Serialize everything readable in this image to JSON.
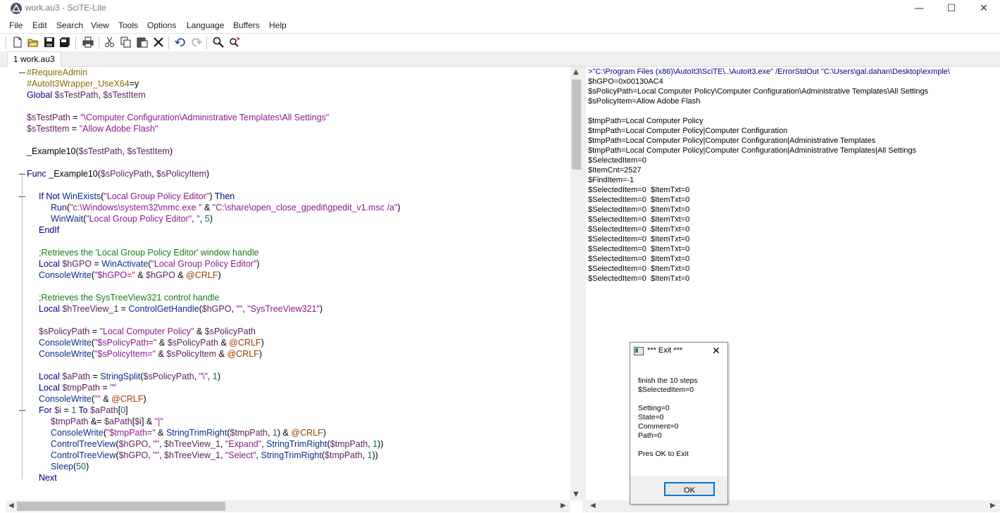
{
  "window": {
    "title": "work.au3 - SciTE-Lite",
    "minimize": "—",
    "maximize": "☐",
    "close": "✕"
  },
  "menu": [
    "File",
    "Edit",
    "Search",
    "View",
    "Tools",
    "Options",
    "Language",
    "Buffers",
    "Help"
  ],
  "toolbar": [
    "new-icon",
    "open-icon",
    "save-icon",
    "save-all-icon",
    "print-icon",
    "cut-icon",
    "copy-icon",
    "paste-icon",
    "delete-icon",
    "undo-icon",
    "redo-icon",
    "find-icon",
    "replace-icon"
  ],
  "tabs": [
    {
      "label": "1 work.au3"
    }
  ],
  "editor_lines": [
    {
      "indent": 0,
      "fold": "start",
      "tokens": [
        [
          "dir",
          "#RequireAdmin"
        ]
      ]
    },
    {
      "indent": 0,
      "tokens": [
        [
          "dir",
          "#AutoIt3Wrapper_UseX64"
        ],
        [
          "op",
          "=y"
        ]
      ]
    },
    {
      "indent": 0,
      "tokens": [
        [
          "kw",
          "Global "
        ],
        [
          "var",
          "$sTestPath"
        ],
        [
          "op",
          ", "
        ],
        [
          "var",
          "$sTestItem"
        ]
      ]
    },
    {
      "indent": 0,
      "tokens": []
    },
    {
      "indent": 0,
      "tokens": [
        [
          "var",
          "$sTestPath"
        ],
        [
          "op",
          " = "
        ],
        [
          "str",
          "\"\\Computer Configuration\\Administrative Templates\\All Settings\""
        ]
      ]
    },
    {
      "indent": 0,
      "tokens": [
        [
          "var",
          "$sTestItem"
        ],
        [
          "op",
          " = "
        ],
        [
          "str",
          "\"Allow Adobe Flash\""
        ]
      ]
    },
    {
      "indent": 0,
      "tokens": []
    },
    {
      "indent": 0,
      "tokens": [
        [
          "op",
          "_Example10("
        ],
        [
          "var",
          "$sTestPath"
        ],
        [
          "op",
          ", "
        ],
        [
          "var",
          "$sTestItem"
        ],
        [
          "op",
          ")"
        ]
      ]
    },
    {
      "indent": 0,
      "tokens": []
    },
    {
      "indent": 0,
      "fold": "start",
      "tokens": [
        [
          "kw",
          "Func "
        ],
        [
          "op",
          "_Example10("
        ],
        [
          "var",
          "$sPolicyPath"
        ],
        [
          "op",
          ", "
        ],
        [
          "var",
          "$sPolicyItem"
        ],
        [
          "op",
          ")"
        ]
      ]
    },
    {
      "indent": 0,
      "tokens": []
    },
    {
      "indent": 1,
      "fold": "start",
      "tokens": [
        [
          "kw",
          "If Not "
        ],
        [
          "func",
          "WinExists"
        ],
        [
          "op",
          "("
        ],
        [
          "str",
          "\"Local Group Policy Editor\""
        ],
        [
          "op",
          ") "
        ],
        [
          "kw",
          "Then"
        ]
      ]
    },
    {
      "indent": 2,
      "tokens": [
        [
          "func",
          "Run"
        ],
        [
          "op",
          "("
        ],
        [
          "str",
          "\"c:\\Windows\\system32\\mmc.exe \""
        ],
        [
          "op",
          " & "
        ],
        [
          "str",
          "\"C:\\share\\open_close_gpedit\\gpedit_v1.msc /a\""
        ],
        [
          "op",
          ")"
        ]
      ]
    },
    {
      "indent": 2,
      "tokens": [
        [
          "func",
          "WinWait"
        ],
        [
          "op",
          "("
        ],
        [
          "str",
          "\"Local Group Policy Editor\""
        ],
        [
          "op",
          ", "
        ],
        [
          "str",
          "''"
        ],
        [
          "op",
          ", "
        ],
        [
          "num",
          "5"
        ],
        [
          "op",
          ")"
        ]
      ]
    },
    {
      "indent": 1,
      "tokens": [
        [
          "kw",
          "EndIf"
        ]
      ]
    },
    {
      "indent": 0,
      "tokens": []
    },
    {
      "indent": 1,
      "tokens": [
        [
          "cmt",
          ";Retrieves the 'Local Group Policy Editor' window handle"
        ]
      ]
    },
    {
      "indent": 1,
      "tokens": [
        [
          "kw",
          "Local "
        ],
        [
          "var",
          "$hGPO"
        ],
        [
          "op",
          " = "
        ],
        [
          "func",
          "WinActivate"
        ],
        [
          "op",
          "("
        ],
        [
          "str",
          "\"Local Group Policy Editor\""
        ],
        [
          "op",
          ")"
        ]
      ]
    },
    {
      "indent": 1,
      "tokens": [
        [
          "func",
          "ConsoleWrite"
        ],
        [
          "op",
          "("
        ],
        [
          "str",
          "\"$hGPO=\""
        ],
        [
          "op",
          " & "
        ],
        [
          "var",
          "$hGPO"
        ],
        [
          "op",
          " & "
        ],
        [
          "mac",
          "@CRLF"
        ],
        [
          "op",
          ")"
        ]
      ]
    },
    {
      "indent": 0,
      "tokens": []
    },
    {
      "indent": 1,
      "tokens": [
        [
          "cmt",
          ";Retrieves the SysTreeView321 control handle"
        ]
      ]
    },
    {
      "indent": 1,
      "tokens": [
        [
          "kw",
          "Local "
        ],
        [
          "var",
          "$hTreeView_1"
        ],
        [
          "op",
          " = "
        ],
        [
          "func",
          "ControlGetHandle"
        ],
        [
          "op",
          "("
        ],
        [
          "var",
          "$hGPO"
        ],
        [
          "op",
          ", "
        ],
        [
          "str",
          "\"\""
        ],
        [
          "op",
          ", "
        ],
        [
          "str",
          "\"SysTreeView321\""
        ],
        [
          "op",
          ")"
        ]
      ]
    },
    {
      "indent": 0,
      "tokens": []
    },
    {
      "indent": 1,
      "tokens": [
        [
          "var",
          "$sPolicyPath"
        ],
        [
          "op",
          " = "
        ],
        [
          "str",
          "\"Local Computer Policy\""
        ],
        [
          "op",
          " & "
        ],
        [
          "var",
          "$sPolicyPath"
        ]
      ]
    },
    {
      "indent": 1,
      "tokens": [
        [
          "func",
          "ConsoleWrite"
        ],
        [
          "op",
          "("
        ],
        [
          "str",
          "\"$sPolicyPath=\""
        ],
        [
          "op",
          " & "
        ],
        [
          "var",
          "$sPolicyPath"
        ],
        [
          "op",
          " & "
        ],
        [
          "mac",
          "@CRLF"
        ],
        [
          "op",
          ")"
        ]
      ]
    },
    {
      "indent": 1,
      "tokens": [
        [
          "func",
          "ConsoleWrite"
        ],
        [
          "op",
          "("
        ],
        [
          "str",
          "\"$sPolicyItem=\""
        ],
        [
          "op",
          " & "
        ],
        [
          "var",
          "$sPolicyItem"
        ],
        [
          "op",
          " & "
        ],
        [
          "mac",
          "@CRLF"
        ],
        [
          "op",
          ")"
        ]
      ]
    },
    {
      "indent": 0,
      "tokens": []
    },
    {
      "indent": 1,
      "tokens": [
        [
          "kw",
          "Local "
        ],
        [
          "var",
          "$aPath"
        ],
        [
          "op",
          " = "
        ],
        [
          "func",
          "StringSplit"
        ],
        [
          "op",
          "("
        ],
        [
          "var",
          "$sPolicyPath"
        ],
        [
          "op",
          ", "
        ],
        [
          "str",
          "\"\\\""
        ],
        [
          "op",
          ", "
        ],
        [
          "num",
          "1"
        ],
        [
          "op",
          ")"
        ]
      ]
    },
    {
      "indent": 1,
      "tokens": [
        [
          "kw",
          "Local "
        ],
        [
          "var",
          "$tmpPath"
        ],
        [
          "op",
          " = "
        ],
        [
          "str",
          "\"\""
        ]
      ]
    },
    {
      "indent": 1,
      "tokens": [
        [
          "func",
          "ConsoleWrite"
        ],
        [
          "op",
          "("
        ],
        [
          "str",
          "\"\""
        ],
        [
          "op",
          " & "
        ],
        [
          "mac",
          "@CRLF"
        ],
        [
          "op",
          ")"
        ]
      ]
    },
    {
      "indent": 1,
      "fold": "start",
      "tokens": [
        [
          "kw",
          "For "
        ],
        [
          "var",
          "$i"
        ],
        [
          "op",
          " = "
        ],
        [
          "num",
          "1"
        ],
        [
          "kw",
          " To "
        ],
        [
          "var",
          "$aPath"
        ],
        [
          "op",
          "["
        ],
        [
          "num",
          "0"
        ],
        [
          "op",
          "]"
        ]
      ]
    },
    {
      "indent": 2,
      "tokens": [
        [
          "var",
          "$tmpPath"
        ],
        [
          "op",
          " &= "
        ],
        [
          "var",
          "$aPath"
        ],
        [
          "op",
          "["
        ],
        [
          "var",
          "$i"
        ],
        [
          "op",
          "] & "
        ],
        [
          "str",
          "\"|\""
        ]
      ]
    },
    {
      "indent": 2,
      "tokens": [
        [
          "func",
          "ConsoleWrite"
        ],
        [
          "op",
          "("
        ],
        [
          "str",
          "\"$tmpPath=\""
        ],
        [
          "op",
          " & "
        ],
        [
          "func",
          "StringTrimRight"
        ],
        [
          "op",
          "("
        ],
        [
          "var",
          "$tmpPath"
        ],
        [
          "op",
          ", "
        ],
        [
          "num",
          "1"
        ],
        [
          "op",
          ") & "
        ],
        [
          "mac",
          "@CRLF"
        ],
        [
          "op",
          ")"
        ]
      ]
    },
    {
      "indent": 2,
      "tokens": [
        [
          "func",
          "ControlTreeView"
        ],
        [
          "op",
          "("
        ],
        [
          "var",
          "$hGPO"
        ],
        [
          "op",
          ", "
        ],
        [
          "str",
          "\"\""
        ],
        [
          "op",
          ", "
        ],
        [
          "var",
          "$hTreeView_1"
        ],
        [
          "op",
          ", "
        ],
        [
          "str",
          "\"Expand\""
        ],
        [
          "op",
          ", "
        ],
        [
          "func",
          "StringTrimRight"
        ],
        [
          "op",
          "("
        ],
        [
          "var",
          "$tmpPath"
        ],
        [
          "op",
          ", "
        ],
        [
          "num",
          "1"
        ],
        [
          "op",
          "))"
        ]
      ]
    },
    {
      "indent": 2,
      "tokens": [
        [
          "func",
          "ControlTreeView"
        ],
        [
          "op",
          "("
        ],
        [
          "var",
          "$hGPO"
        ],
        [
          "op",
          ", "
        ],
        [
          "str",
          "\"\""
        ],
        [
          "op",
          ", "
        ],
        [
          "var",
          "$hTreeView_1"
        ],
        [
          "op",
          ", "
        ],
        [
          "str",
          "\"Select\""
        ],
        [
          "op",
          ", "
        ],
        [
          "func",
          "StringTrimRight"
        ],
        [
          "op",
          "("
        ],
        [
          "var",
          "$tmpPath"
        ],
        [
          "op",
          ", "
        ],
        [
          "num",
          "1"
        ],
        [
          "op",
          "))"
        ]
      ]
    },
    {
      "indent": 2,
      "tokens": [
        [
          "func",
          "Sleep"
        ],
        [
          "op",
          "("
        ],
        [
          "num",
          "50"
        ],
        [
          "op",
          ")"
        ]
      ]
    },
    {
      "indent": 1,
      "tokens": [
        [
          "kw",
          "Next"
        ]
      ]
    }
  ],
  "output_lines": [
    ">\"C:\\Program Files (x86)\\AutoIt3\\SciTE\\..\\AutoIt3.exe\" /ErrorStdOut \"C:\\Users\\gal.dahan\\Desktop\\exmple\\",
    "$hGPO=0x00130AC4",
    "$sPolicyPath=Local Computer Policy\\Computer Configuration\\Administrative Templates\\All Settings",
    "$sPolicyItem=Allow Adobe Flash",
    "",
    "$tmpPath=Local Computer Policy",
    "$tmpPath=Local Computer Policy|Computer Configuration",
    "$tmpPath=Local Computer Policy|Computer Configuration|Administrative Templates",
    "$tmpPath=Local Computer Policy|Computer Configuration|Administrative Templates|All Settings",
    "$SelectedItem=0",
    "$ItemCnt=2527",
    "$FindItem=-1",
    "$SelectedItem=0  $ItemTxt=0",
    "$SelectedItem=0  $ItemTxt=0",
    "$SelectedItem=0  $ItemTxt=0",
    "$SelectedItem=0  $ItemTxt=0",
    "$SelectedItem=0  $ItemTxt=0",
    "$SelectedItem=0  $ItemTxt=0",
    "$SelectedItem=0  $ItemTxt=0",
    "$SelectedItem=0  $ItemTxt=0",
    "$SelectedItem=0  $ItemTxt=0",
    "$SelectedItem=0  $ItemTxt=0"
  ],
  "dialog": {
    "title": "*** Exit ***",
    "close": "✕",
    "lines": [
      "finish the 10 steps",
      "$SelectedItem=0",
      "",
      "Setting=0",
      "State=0",
      "Comment=0",
      "Path=0",
      "",
      "Pres OK to Exit"
    ],
    "ok_label": "OK"
  },
  "colors": {
    "keyword": "#00008b",
    "variable": "#5a1e5a",
    "string": "#8b1a8b",
    "comment": "#1a7a1a",
    "directive": "#8a6d00",
    "number": "#0a6a6a",
    "macro": "#9a3a00"
  }
}
